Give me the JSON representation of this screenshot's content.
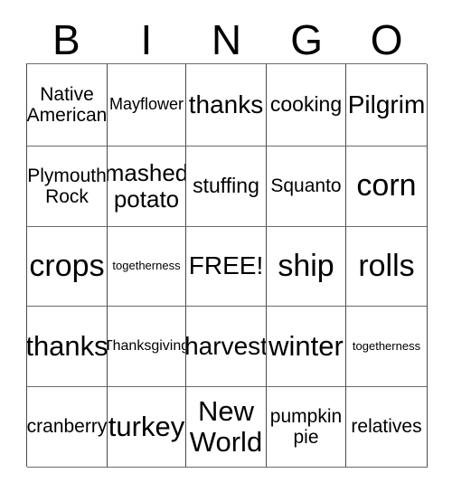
{
  "card": {
    "title": "BINGO",
    "header_letters": [
      "B",
      "I",
      "N",
      "G",
      "O"
    ],
    "free_space": "FREE!",
    "colors": {
      "background": "#ffffff",
      "text": "#000000",
      "grid_line": "#4a4a4a"
    },
    "rows": [
      [
        {
          "text": "Native\nAmerican",
          "size": "fs-m"
        },
        {
          "text": "Mayflower",
          "size": "fs-sm"
        },
        {
          "text": "thanks",
          "size": "fs-xl"
        },
        {
          "text": "cooking",
          "size": "fs-ml"
        },
        {
          "text": "Pilgrim",
          "size": "fs-xl"
        }
      ],
      [
        {
          "text": "Plymouth\nRock",
          "size": "fs-m"
        },
        {
          "text": "mashed\npotato",
          "size": "fs-l"
        },
        {
          "text": "stuffing",
          "size": "fs-ml"
        },
        {
          "text": "Squanto",
          "size": "fs-m"
        },
        {
          "text": "corn",
          "size": "fs-3xl"
        }
      ],
      [
        {
          "text": "crops",
          "size": "fs-3xl"
        },
        {
          "text": "togetherness",
          "size": "fs-xs"
        },
        {
          "text": "FREE!",
          "size": "fs-xl"
        },
        {
          "text": "ship",
          "size": "fs-3xl"
        },
        {
          "text": "rolls",
          "size": "fs-3xl"
        }
      ],
      [
        {
          "text": "thanks",
          "size": "fs-2xl"
        },
        {
          "text": "Thanksgiving",
          "size": "fs-s"
        },
        {
          "text": "harvest",
          "size": "fs-xl"
        },
        {
          "text": "winter",
          "size": "fs-2xl"
        },
        {
          "text": "togetherness",
          "size": "fs-xs"
        }
      ],
      [
        {
          "text": "cranberry",
          "size": "fs-m"
        },
        {
          "text": "turkey",
          "size": "fs-2xl"
        },
        {
          "text": "New\nWorld",
          "size": "fs-2xl"
        },
        {
          "text": "pumpkin\npie",
          "size": "fs-m"
        },
        {
          "text": "relatives",
          "size": "fs-m"
        }
      ]
    ]
  }
}
